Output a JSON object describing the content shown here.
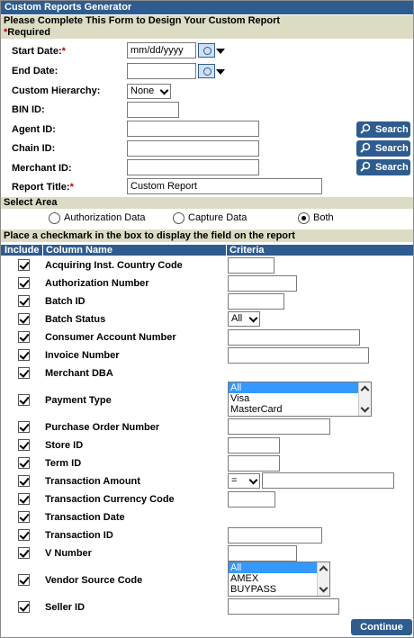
{
  "title": "Custom Reports Generator",
  "intro": {
    "line1": "Please Complete This Form to Design Your Custom Report",
    "req_star": "*",
    "line2": "Required"
  },
  "form": {
    "start_date_label": "Start Date:",
    "start_date_value": "mm/dd/yyyy",
    "end_date_label": "End Date:",
    "end_date_value": "",
    "hierarchy_label": "Custom Hierarchy:",
    "hierarchy_value": "None",
    "bin_label": "BIN ID:",
    "agent_label": "Agent ID:",
    "chain_label": "Chain ID:",
    "merchant_label": "Merchant ID:",
    "report_title_label": "Report Title:",
    "report_title_value": "Custom Report",
    "search_label": "Search",
    "star": "*"
  },
  "area": {
    "title": "Select Area",
    "options": [
      "Authorization Data",
      "Capture Data",
      "Both"
    ],
    "selected": "Both"
  },
  "columns_band": "Place a checkmark in the box to display the field on the report",
  "table_headers": {
    "include": "Include",
    "column": "Column Name",
    "criteria": "Criteria"
  },
  "rows": [
    "Acquiring Inst. Country Code",
    "Authorization Number",
    "Batch ID",
    "Batch Status",
    "Consumer Account Number",
    "Invoice Number",
    "Merchant DBA",
    "Payment Type",
    "Purchase Order Number",
    "Store ID",
    "Term ID",
    "Transaction Amount",
    "Transaction Currency Code",
    "Transaction Date",
    "Transaction ID",
    "V Number",
    "Vendor Source Code",
    "Seller ID"
  ],
  "criteria": {
    "batch_status": "All",
    "payment_type_options": [
      "All",
      "Visa",
      "MasterCard"
    ],
    "amount_operator": "=",
    "vendor_options": [
      "All",
      "AMEX",
      "BUYPASS"
    ]
  },
  "continue_label": "Continue",
  "colors": {
    "accent": "#2f5c8f",
    "band": "#dcdcc4",
    "required": "#c00000",
    "selection": "#3399ff"
  }
}
